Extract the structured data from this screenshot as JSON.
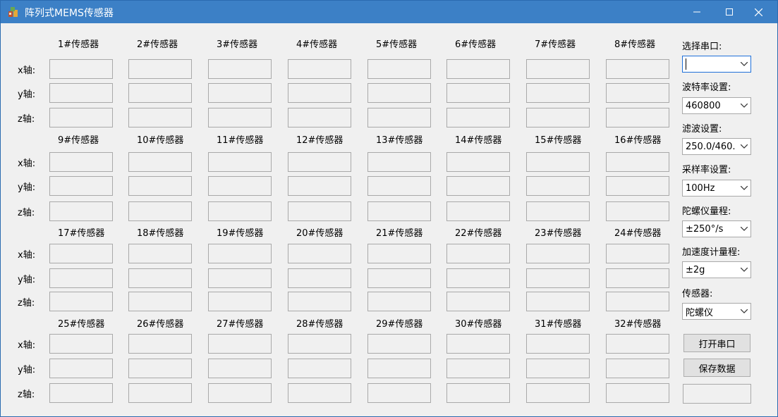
{
  "window": {
    "title": "阵列式MEMS传感器"
  },
  "sensors": [
    "1#传感器",
    "2#传感器",
    "3#传感器",
    "4#传感器",
    "5#传感器",
    "6#传感器",
    "7#传感器",
    "8#传感器",
    "9#传感器",
    "10#传感器",
    "11#传感器",
    "12#传感器",
    "13#传感器",
    "14#传感器",
    "15#传感器",
    "16#传感器",
    "17#传感器",
    "18#传感器",
    "19#传感器",
    "20#传感器",
    "21#传感器",
    "22#传感器",
    "23#传感器",
    "24#传感器",
    "25#传感器",
    "26#传感器",
    "27#传感器",
    "28#传感器",
    "29#传感器",
    "30#传感器",
    "31#传感器",
    "32#传感器"
  ],
  "axes": [
    "x轴:",
    "y轴:",
    "z轴:"
  ],
  "settings": {
    "port_label": "选择串口:",
    "port_value": "",
    "baud_label": "波特率设置:",
    "baud_value": "460800",
    "filter_label": "滤波设置:",
    "filter_value": "250.0/460.",
    "sample_label": "采样率设置:",
    "sample_value": "100Hz",
    "gyro_label": "陀螺仪量程:",
    "gyro_value": "±250°/s",
    "accel_label": "加速度计量程:",
    "accel_value": "±2g",
    "sensor_label": "传感器:",
    "sensor_value": "陀螺仪",
    "open_button": "打开串口",
    "save_button": "保存数据"
  },
  "colors": {
    "titlebar": "#3c80c6",
    "background": "#f0f0f0",
    "border": "#a9a9a9",
    "focus": "#1e6fd9"
  }
}
